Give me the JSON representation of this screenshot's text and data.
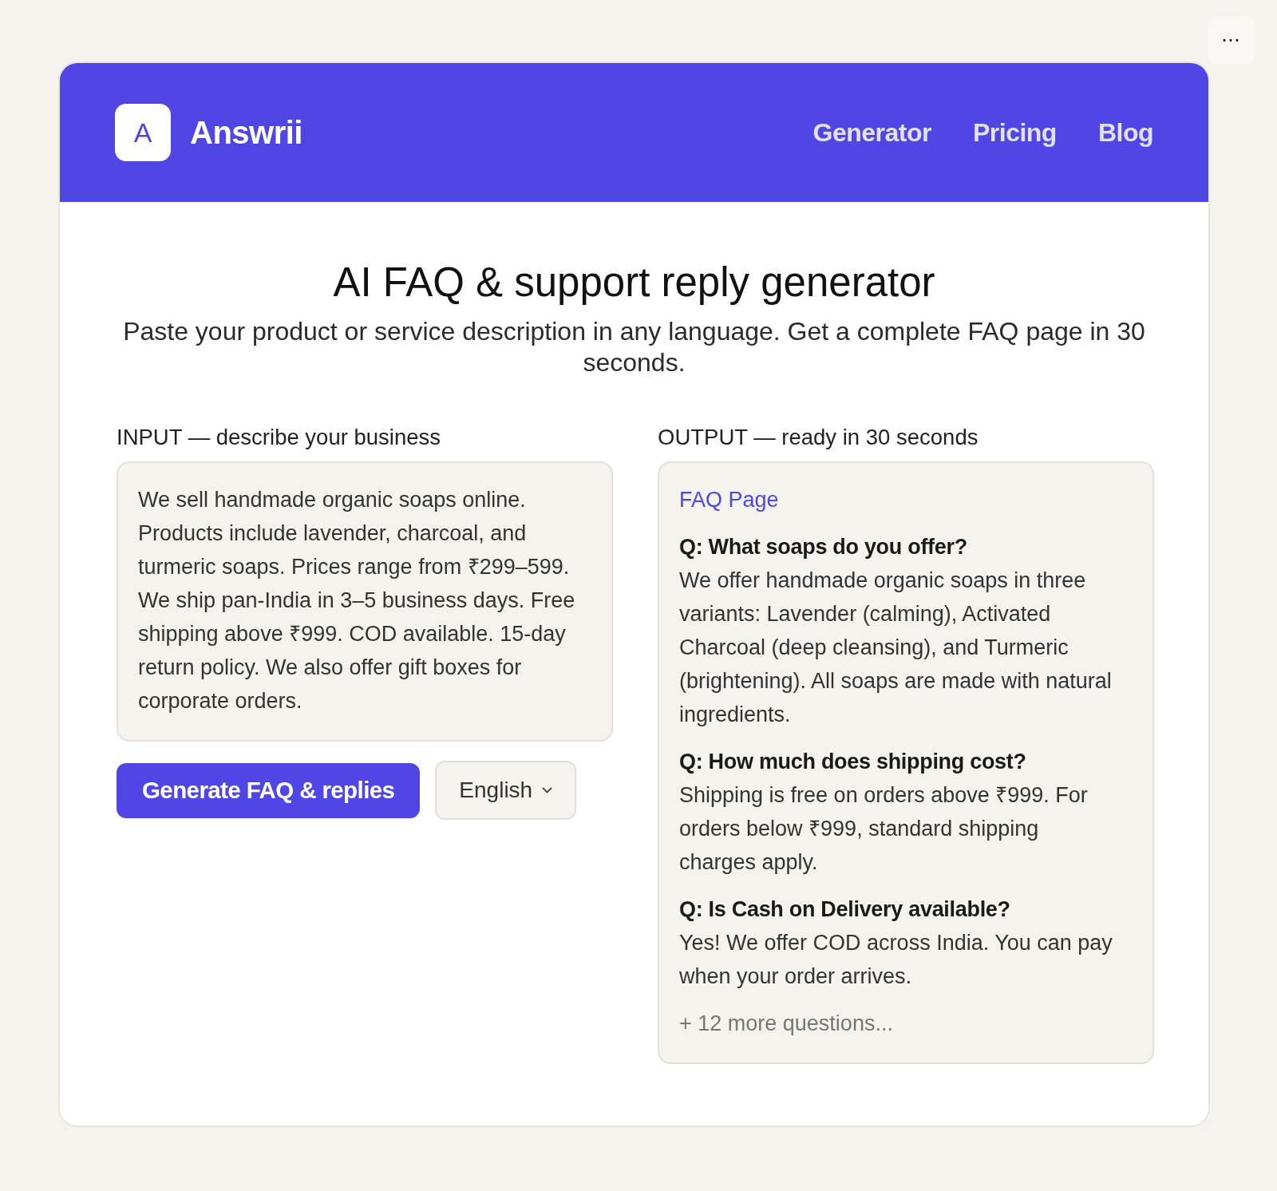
{
  "menu_button": {
    "label": "⋯"
  },
  "header": {
    "logo_letter": "A",
    "brand": "Answrii",
    "nav": [
      {
        "label": "Generator"
      },
      {
        "label": "Pricing"
      },
      {
        "label": "Blog"
      }
    ]
  },
  "hero": {
    "title": "AI FAQ & support reply generator",
    "subtitle": "Paste your product or service description in any language. Get a complete FAQ page in 30 seconds."
  },
  "input_panel": {
    "label": "INPUT — describe your business",
    "description": "We sell handmade organic soaps online. Products include lavender, charcoal, and turmeric soaps. Prices range from ₹299–599. We ship pan-India in 3–5 business days. Free shipping above ₹999. COD available. 15-day return policy. We also offer gift boxes for corporate orders.",
    "generate_button": "Generate FAQ & replies",
    "language": "English"
  },
  "output_panel": {
    "label": "OUTPUT — ready in 30 seconds",
    "heading": "FAQ Page",
    "faqs": [
      {
        "question": "Q: What soaps do you offer?",
        "answer": "We offer handmade organic soaps in three variants: Lavender (calming), Activated Charcoal (deep cleansing), and Turmeric (brightening). All soaps are made with natural ingredients."
      },
      {
        "question": "Q: How much does shipping cost?",
        "answer": "Shipping is free on orders above ₹999. For orders below ₹999, standard shipping charges apply."
      },
      {
        "question": "Q: Is Cash on Delivery available?",
        "answer": "Yes! We offer COD across India. You can pay when your order arrives."
      }
    ],
    "more": "+ 12 more questions..."
  }
}
